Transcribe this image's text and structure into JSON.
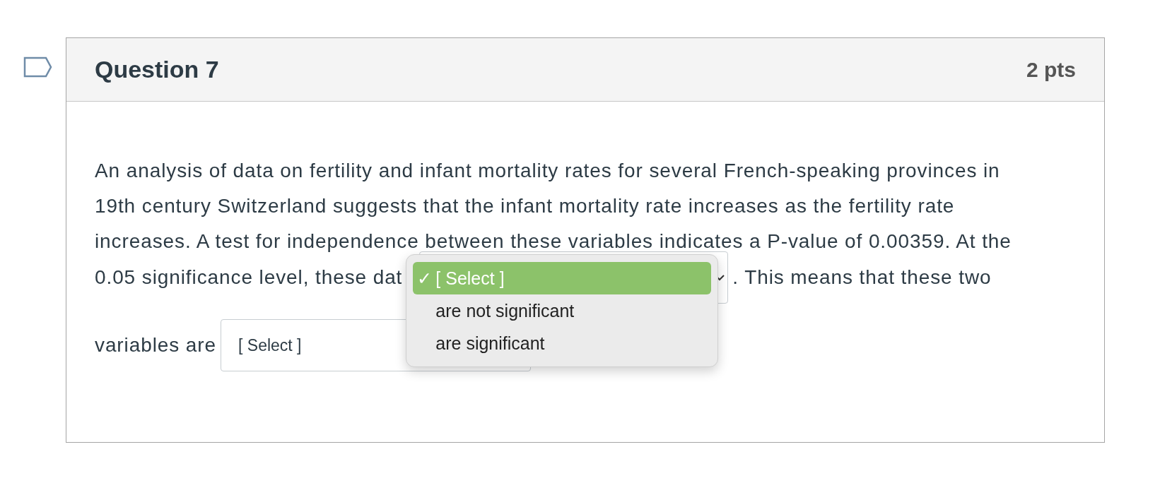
{
  "question": {
    "title": "Question 7",
    "points": "2 pts"
  },
  "text_lines": [
    "An analysis of data on fertility and infant mortality rates for several French-speaking provinces in",
    "19th century Switzerland suggests that the infant mortality rate increases as the fertility rate",
    "increases. A test for independence between these variables indicates a P-value of 0.00359. At the"
  ],
  "blank_rows": [
    {
      "before": "0.05 significance level, these dat",
      "after": ". This means that these two",
      "dropdown": {
        "expanded": true,
        "options": [
          {
            "check": "✓",
            "label": "[ Select ]",
            "selected": true
          },
          {
            "label": "are not significant",
            "selected": false
          },
          {
            "label": "are significant",
            "selected": false
          }
        ]
      }
    },
    {
      "before": "variables are",
      "dropdown": {
        "expanded": false,
        "value": "[ Select ]"
      }
    }
  ]
}
